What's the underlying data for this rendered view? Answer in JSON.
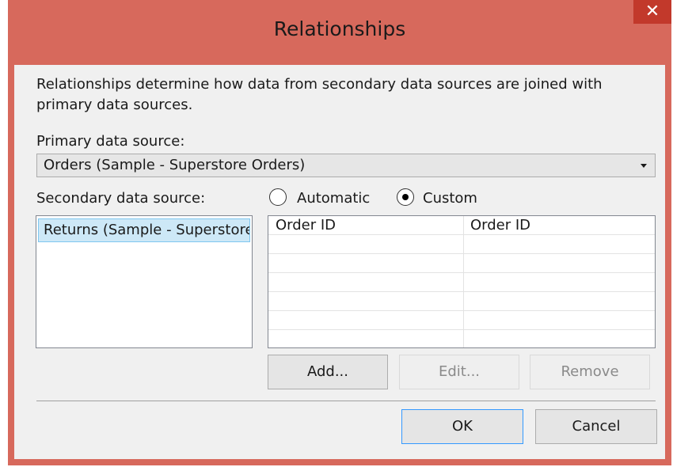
{
  "window": {
    "title": "Relationships",
    "close_glyph": "✕",
    "frame_color": "#d7695c",
    "close_color": "#c2392b"
  },
  "description": "Relationships determine how data from secondary data sources are joined with primary data sources.",
  "primary": {
    "label": "Primary data source:",
    "selected": "Orders (Sample - Superstore Orders)"
  },
  "secondary": {
    "label": "Secondary data source:",
    "items": [
      {
        "label": "Returns (Sample - Superstore Returns)",
        "selected": true
      }
    ]
  },
  "mode": {
    "automatic_label": "Automatic",
    "custom_label": "Custom",
    "selected": "Custom"
  },
  "mapping": {
    "rows": [
      {
        "primary_field": "Order ID",
        "secondary_field": "Order ID"
      }
    ],
    "empty_row_count": 6
  },
  "buttons": {
    "add": "Add...",
    "edit": "Edit...",
    "remove": "Remove",
    "ok": "OK",
    "cancel": "Cancel"
  }
}
